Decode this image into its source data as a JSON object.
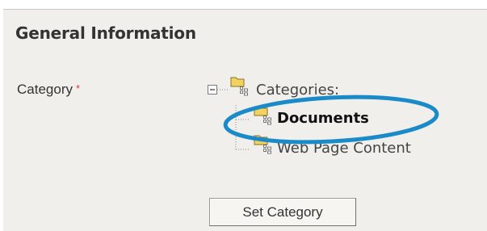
{
  "section": {
    "title": "General Information"
  },
  "category_field": {
    "label": "Category",
    "required_mark": "*"
  },
  "tree": {
    "root": {
      "label": "Categories:",
      "expanded": true,
      "icon": "folder-icon"
    },
    "children": [
      {
        "label": "Documents",
        "selected": true,
        "icon": "folder-icon"
      },
      {
        "label": "Web Page Content",
        "selected": false,
        "icon": "folder-icon"
      }
    ]
  },
  "actions": {
    "set_category_label": "Set Category"
  },
  "colors": {
    "panel_background": "#f0efec",
    "highlight_ellipse": "#1a8ac9",
    "required": "#e03c31",
    "folder": "#f2d35e"
  }
}
